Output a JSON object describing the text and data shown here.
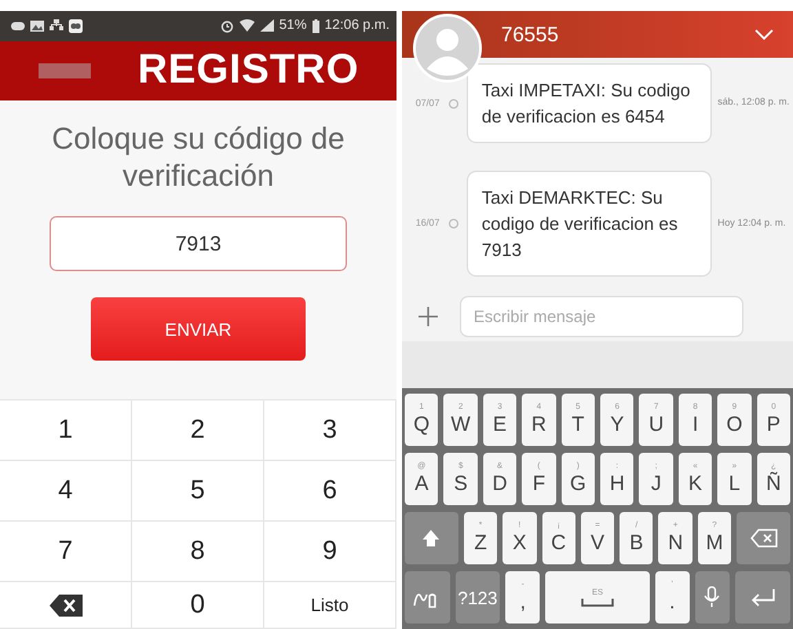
{
  "registration_screen": {
    "status_bar": {
      "battery": "51%",
      "time": "12:06 p.m."
    },
    "header": {
      "title": "REGISTRO"
    },
    "prompt": "Coloque su código de verificación",
    "code_field": {
      "value": "7913"
    },
    "send_button": "ENVIAR",
    "keypad": [
      {
        "kind": "digit",
        "label": "1"
      },
      {
        "kind": "digit",
        "label": "2"
      },
      {
        "kind": "digit",
        "label": "3"
      },
      {
        "kind": "digit",
        "label": "4"
      },
      {
        "kind": "digit",
        "label": "5"
      },
      {
        "kind": "digit",
        "label": "6"
      },
      {
        "kind": "digit",
        "label": "7"
      },
      {
        "kind": "digit",
        "label": "8"
      },
      {
        "kind": "digit",
        "label": "9"
      },
      {
        "kind": "backspace"
      },
      {
        "kind": "digit",
        "label": "0"
      },
      {
        "kind": "text",
        "label": "Listo"
      }
    ]
  },
  "messages_screen": {
    "header": {
      "title": "76555"
    },
    "messages": [
      {
        "date": "07/07",
        "text": "Taxi IMPETAXI:  Su codigo de verificacion es 6454",
        "time": "sáb., 12:08 p. m."
      },
      {
        "date": "16/07",
        "text": "Taxi DEMARKTEC:  Su codigo de verificacion es 7913",
        "time": "Hoy 12:04 p. m."
      }
    ],
    "compose": {
      "placeholder": "Escribir mensaje"
    },
    "keyboard": [
      [
        {
          "kind": "letter",
          "label": "Q",
          "hint": "1"
        },
        {
          "kind": "letter",
          "label": "W",
          "hint": "2"
        },
        {
          "kind": "letter",
          "label": "E",
          "hint": "3"
        },
        {
          "kind": "letter",
          "label": "R",
          "hint": "4"
        },
        {
          "kind": "letter",
          "label": "T",
          "hint": "5"
        },
        {
          "kind": "letter",
          "label": "Y",
          "hint": "6"
        },
        {
          "kind": "letter",
          "label": "U",
          "hint": "7"
        },
        {
          "kind": "letter",
          "label": "I",
          "hint": "8"
        },
        {
          "kind": "letter",
          "label": "O",
          "hint": "9"
        },
        {
          "kind": "letter",
          "label": "P",
          "hint": "0"
        }
      ],
      [
        {
          "kind": "letter",
          "label": "A",
          "hint": "@"
        },
        {
          "kind": "letter",
          "label": "S",
          "hint": "$"
        },
        {
          "kind": "letter",
          "label": "D",
          "hint": "&"
        },
        {
          "kind": "letter",
          "label": "F",
          "hint": "("
        },
        {
          "kind": "letter",
          "label": "G",
          "hint": ")"
        },
        {
          "kind": "letter",
          "label": "H",
          "hint": ":"
        },
        {
          "kind": "letter",
          "label": "J",
          "hint": ";"
        },
        {
          "kind": "letter",
          "label": "K",
          "hint": "«"
        },
        {
          "kind": "letter",
          "label": "L",
          "hint": "»"
        },
        {
          "kind": "letter",
          "label": "Ñ",
          "hint": "¿"
        }
      ],
      [
        {
          "kind": "shift"
        },
        {
          "kind": "letter",
          "label": "Z",
          "hint": "*"
        },
        {
          "kind": "letter",
          "label": "X",
          "hint": "!"
        },
        {
          "kind": "letter",
          "label": "C",
          "hint": "¡"
        },
        {
          "kind": "letter",
          "label": "V",
          "hint": "="
        },
        {
          "kind": "letter",
          "label": "B",
          "hint": "/"
        },
        {
          "kind": "letter",
          "label": "N",
          "hint": "+"
        },
        {
          "kind": "letter",
          "label": "M",
          "hint": "?"
        },
        {
          "kind": "delete"
        }
      ],
      [
        {
          "kind": "handwriting"
        },
        {
          "kind": "symbols",
          "label": "?123"
        },
        {
          "kind": "letter",
          "label": ",",
          "hint": "-"
        },
        {
          "kind": "space",
          "hint": "ES"
        },
        {
          "kind": "letter",
          "label": ".",
          "hint": "'"
        },
        {
          "kind": "mic"
        },
        {
          "kind": "enter"
        }
      ]
    ]
  }
}
